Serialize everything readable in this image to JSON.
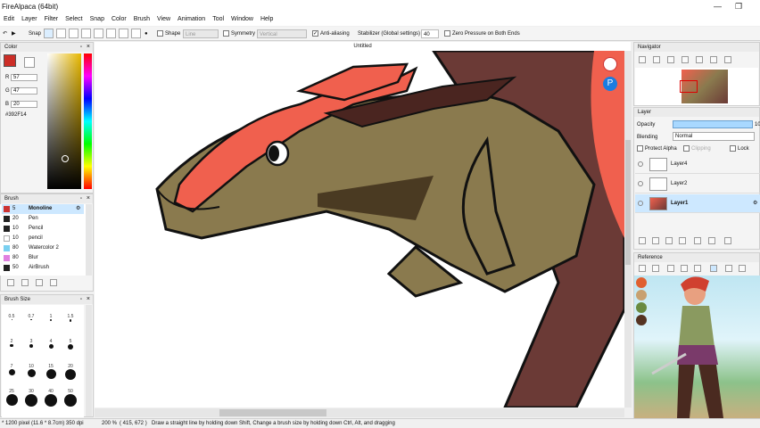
{
  "window": {
    "title": "FireAlpaca (64bit)",
    "doc_tab": "Untitled"
  },
  "menu": [
    "Edit",
    "Layer",
    "Filter",
    "Select",
    "Snap",
    "Color",
    "Brush",
    "View",
    "Animation",
    "Tool",
    "Window",
    "Help"
  ],
  "toolbar": {
    "snap_label": "Snap",
    "shape_label": "Shape",
    "shape_value": "Line",
    "symmetry_label": "Symmetry",
    "symmetry_value": "Vertical",
    "antialias_label": "Anti-aliasing",
    "stabilizer_label": "Stabilizer (Global settings)",
    "stabilizer_value": "40",
    "zero_pressure_label": "Zero Pressure on Both Ends"
  },
  "color_panel": {
    "title": "Color",
    "r_label": "R",
    "r_value": "57",
    "g_label": "G",
    "g_value": "47",
    "b_label": "B",
    "b_value": "20",
    "hex": "#392F14",
    "current_color": "#cc2e27"
  },
  "brush_panel": {
    "title": "Brush",
    "items": [
      {
        "size": "5",
        "name": "Monoline",
        "selected": true,
        "swatch": "#111111"
      },
      {
        "size": "20",
        "name": "Pen",
        "swatch": "#111111"
      },
      {
        "size": "10",
        "name": "Pencil",
        "swatch": "#111111"
      },
      {
        "size": "10",
        "name": "pencil",
        "swatch": "#ffffff"
      },
      {
        "size": "80",
        "name": "Watercolor 2",
        "swatch": "#7ad0f0"
      },
      {
        "size": "80",
        "name": "Blur",
        "swatch": "#e080e0"
      },
      {
        "size": "50",
        "name": "AirBrush",
        "swatch": "#111111"
      }
    ]
  },
  "brush_size_panel": {
    "title": "Brush Size",
    "labels": [
      "0.5",
      "0.7",
      "1",
      "1.5",
      "2",
      "3",
      "4",
      "5",
      "7",
      "10",
      "15",
      "20",
      "25",
      "30",
      "40",
      "50"
    ]
  },
  "navigator": {
    "title": "Navigator"
  },
  "layer_panel": {
    "title": "Layer",
    "opacity_label": "Opacity",
    "opacity_value": "10",
    "blending_label": "Blending",
    "blending_value": "Normal",
    "protect_alpha_label": "Protect Alpha",
    "clipping_label": "Clipping",
    "lock_label": "Lock",
    "layers": [
      {
        "name": "Layer4"
      },
      {
        "name": "Layer2"
      },
      {
        "name": "Layer1",
        "selected": true
      }
    ]
  },
  "reference": {
    "title": "Reference"
  },
  "status": {
    "size": "* 1200 pixel  (11.6 * 8.7cm)  350 dpi",
    "zoom": "200 %",
    "coords": "( 415, 672 )",
    "hint": "Draw a straight line by holding down Shift, Change a brush size by holding down Ctrl, Alt, and dragging"
  },
  "colors": {
    "accent": "#cde8ff",
    "dragon_body": "#8a7a4e",
    "horn": "#f0604e",
    "wing": "#6b3a36"
  }
}
